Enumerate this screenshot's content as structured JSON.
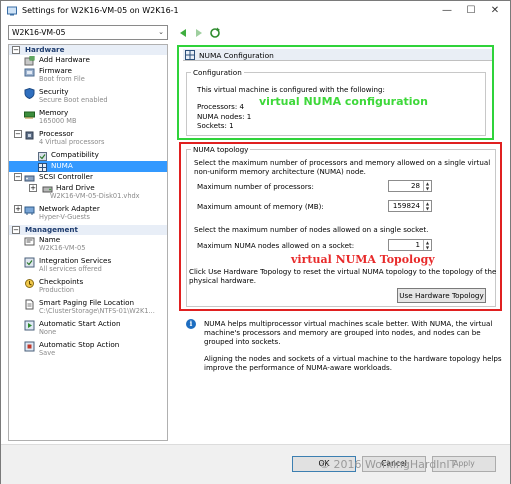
{
  "window": {
    "title": "Settings for W2K16-VM-05 on W2K16-1",
    "minimize": "—",
    "maximize": "☐",
    "close": "✕"
  },
  "vm_selector": {
    "value": "W2K16-VM-05"
  },
  "sidebar": {
    "hardware_label": "Hardware",
    "management_label": "Management",
    "hardware_items": [
      {
        "label": "Add Hardware",
        "sub": "",
        "icon": "add-hardware-icon"
      },
      {
        "label": "Firmware",
        "sub": "Boot from File",
        "icon": "firmware-icon"
      },
      {
        "label": "Security",
        "sub": "Secure Boot enabled",
        "icon": "security-icon"
      },
      {
        "label": "Memory",
        "sub": "165000 MB",
        "icon": "memory-icon"
      },
      {
        "label": "Processor",
        "sub": "4 Virtual processors",
        "icon": "processor-icon"
      },
      {
        "label": "Compatibility",
        "sub": "",
        "icon": "compatibility-icon"
      },
      {
        "label": "NUMA",
        "sub": "",
        "icon": "numa-icon"
      },
      {
        "label": "SCSI Controller",
        "sub": "",
        "icon": "scsi-icon"
      },
      {
        "label": "Hard Drive",
        "sub": "W2K16-VM-05-Disk01.vhdx",
        "icon": "hard-drive-icon"
      },
      {
        "label": "Network Adapter",
        "sub": "Hyper-V-Guests",
        "icon": "network-adapter-icon"
      }
    ],
    "management_items": [
      {
        "label": "Name",
        "sub": "W2K16-VM-05",
        "icon": "name-icon"
      },
      {
        "label": "Integration Services",
        "sub": "All services offered",
        "icon": "integration-icon"
      },
      {
        "label": "Checkpoints",
        "sub": "Production",
        "icon": "checkpoints-icon"
      },
      {
        "label": "Smart Paging File Location",
        "sub": "C:\\ClusterStorage\\NTFS-01\\W2K1...",
        "icon": "paging-icon"
      },
      {
        "label": "Automatic Start Action",
        "sub": "None",
        "icon": "auto-start-icon"
      },
      {
        "label": "Automatic Stop Action",
        "sub": "Save",
        "icon": "auto-stop-icon"
      }
    ]
  },
  "numa": {
    "header": "NUMA Configuration",
    "config_legend": "Configuration",
    "config_intro": "This virtual machine is configured with the following:",
    "processors": "Processors: 4",
    "numa_nodes": "NUMA nodes: 1",
    "sockets": "Sockets: 1",
    "annotation_config": "virtual NUMA configuration",
    "topology_legend": "NUMA topology",
    "topology_desc_1": "Select the maximum number of processors and memory allowed on a single virtual",
    "topology_desc_2": "non-uniform memory architecture (NUMA) node.",
    "max_processors_label": "Maximum number of processors:",
    "max_processors_value": "28",
    "max_memory_label": "Maximum amount of memory (MB):",
    "max_memory_value": "159824",
    "nodes_desc": "Select the maximum number of nodes allowed on a single socket.",
    "max_nodes_label": "Maximum NUMA nodes allowed on a socket:",
    "max_nodes_value": "1",
    "annotation_topology": "virtual NUMA Topology",
    "reset_desc_1": "Click Use Hardware Topology to reset the virtual NUMA topology to the topology of the",
    "reset_desc_2": "physical hardware.",
    "hw_button": "Use Hardware Topology",
    "info_1": "NUMA helps multiprocessor virtual machines scale better.  With NUMA, the virtual",
    "info_2": "machine's processors and memory are grouped into nodes, and nodes can be",
    "info_3": "grouped into sockets.",
    "info_4": "Aligning the nodes and sockets of a virtual machine to the hardware topology helps",
    "info_5": "improve the performance of NUMA-aware workloads."
  },
  "footer": {
    "ok": "OK",
    "cancel": "Cancel",
    "apply": "Apply",
    "copyright": "© 2016 WorkingHardInIT"
  }
}
